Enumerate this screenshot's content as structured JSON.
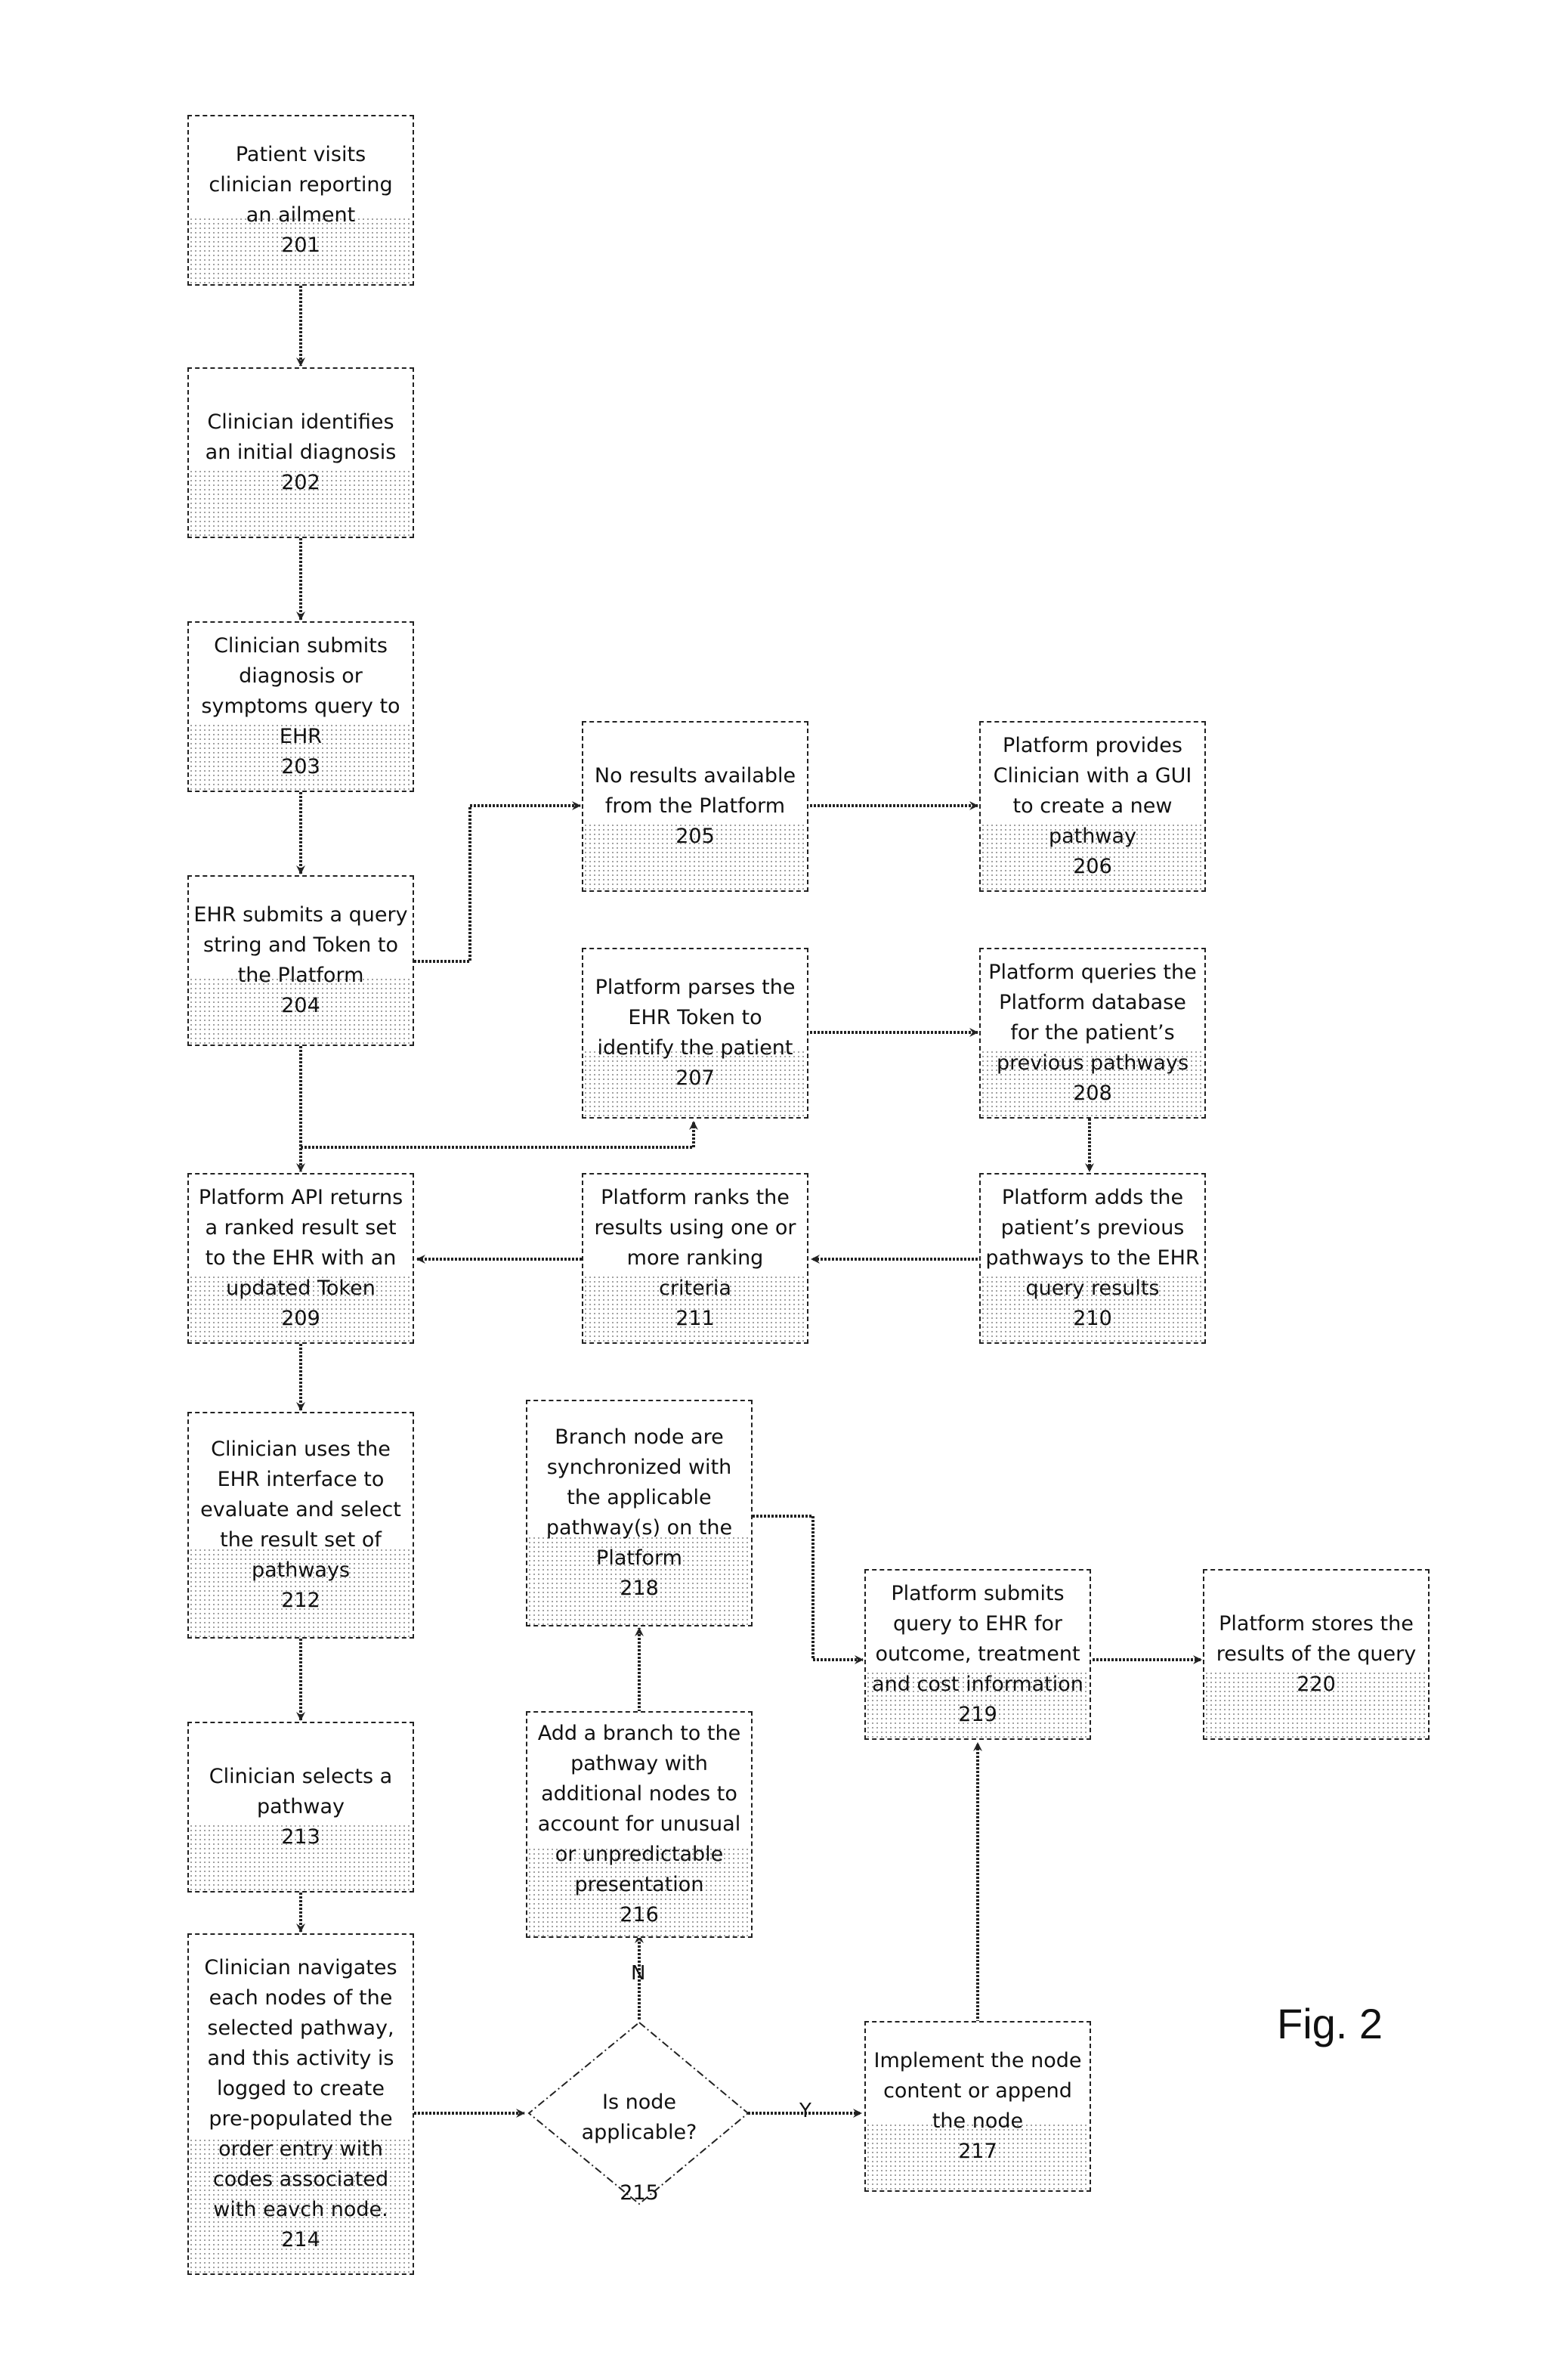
{
  "figure_label": "Fig. 2",
  "nodes": {
    "n201": {
      "text": "Patient visits\nclinician reporting\nan ailment",
      "num": "201"
    },
    "n202": {
      "text": "Clinician identifies\nan initial diagnosis",
      "num": "202"
    },
    "n203": {
      "text": "Clinician submits\ndiagnosis or\nsymptoms query to\nEHR",
      "num": "203"
    },
    "n204": {
      "text": "EHR submits a query\nstring and Token to\nthe Platform",
      "num": "204"
    },
    "n205": {
      "text": "No results available\nfrom the Platform",
      "num": "205"
    },
    "n206": {
      "text": "Platform provides\nClinician with a GUI\nto create a new\npathway",
      "num": "206"
    },
    "n207": {
      "text": "Platform parses the\nEHR Token to\nidentify the patient",
      "num": "207"
    },
    "n208": {
      "text": "Platform queries the\nPlatform database\nfor the patient’s\nprevious pathways",
      "num": "208"
    },
    "n209": {
      "text": "Platform API returns\na ranked result set\nto the EHR with an\nupdated Token",
      "num": "209"
    },
    "n210": {
      "text": "Platform  adds  the\npatient’s previous\npathways to the EHR\nquery results",
      "num": "210"
    },
    "n211": {
      "text": "Platform ranks the\nresults using one or\nmore ranking\ncriteria",
      "num": "211"
    },
    "n212": {
      "text": "Clinician uses the\nEHR interface to\nevaluate and select\nthe result set of\npathways",
      "num": "212"
    },
    "n213": {
      "text": "Clinician selects a\npathway",
      "num": "213"
    },
    "n214": {
      "text": "Clinician navigates\neach nodes of the\nselected pathway,\nand this activity is\nlogged  to create\npre-populated the\norder entry with\ncodes  associated\nwith eavch node.",
      "num": "214"
    },
    "n215": {
      "text": "Is node\napplicable?",
      "num": "215"
    },
    "n216": {
      "text": "Add a branch to the\npathway with\nadditional nodes to\naccount for  unusual\nor unpredictable\npresentation",
      "num": "216"
    },
    "n217": {
      "text": "Implement the node\ncontent or append\nthe node",
      "num": "217"
    },
    "n218": {
      "text": "Branch node are\nsynchronized with\nthe applicable\npathway(s) on the\nPlatform",
      "num": "218"
    },
    "n219": {
      "text": "Platform submits\nquery to EHR for\noutcome, treatment\nand cost information",
      "num": "219"
    },
    "n220": {
      "text": "Platform stores the\nresults of the query",
      "num": "220"
    }
  },
  "edge_labels": {
    "no": "N",
    "yes": "Y"
  }
}
